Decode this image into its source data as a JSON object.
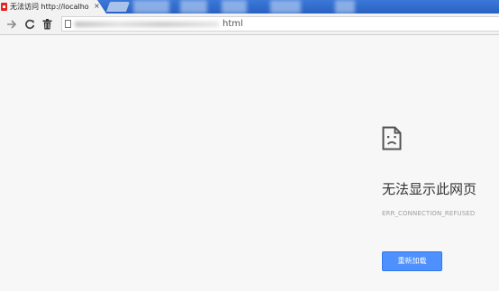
{
  "browser": {
    "tab": {
      "title": "无法访问 http://localhos",
      "close_glyph": "×",
      "favicon": "error-page-icon"
    },
    "new_tab": "new-tab-button",
    "toolbar": {
      "back_icon": "arrow-right-icon",
      "reload_icon": "reload-icon",
      "trash_icon": "trash-icon"
    },
    "omnibox": {
      "url_visible_suffix": "html",
      "page_icon": "page-icon"
    }
  },
  "error_page": {
    "icon": "sad-page-icon",
    "title": "无法显示此网页",
    "error_code": "ERR_CONNECTION_REFUSED",
    "reload_label": "重新加载"
  },
  "colors": {
    "tabstrip": "#2a62c2",
    "page_background": "#f7f7f7",
    "button": "#4d90fe",
    "error_code": "#a0a0a0"
  }
}
